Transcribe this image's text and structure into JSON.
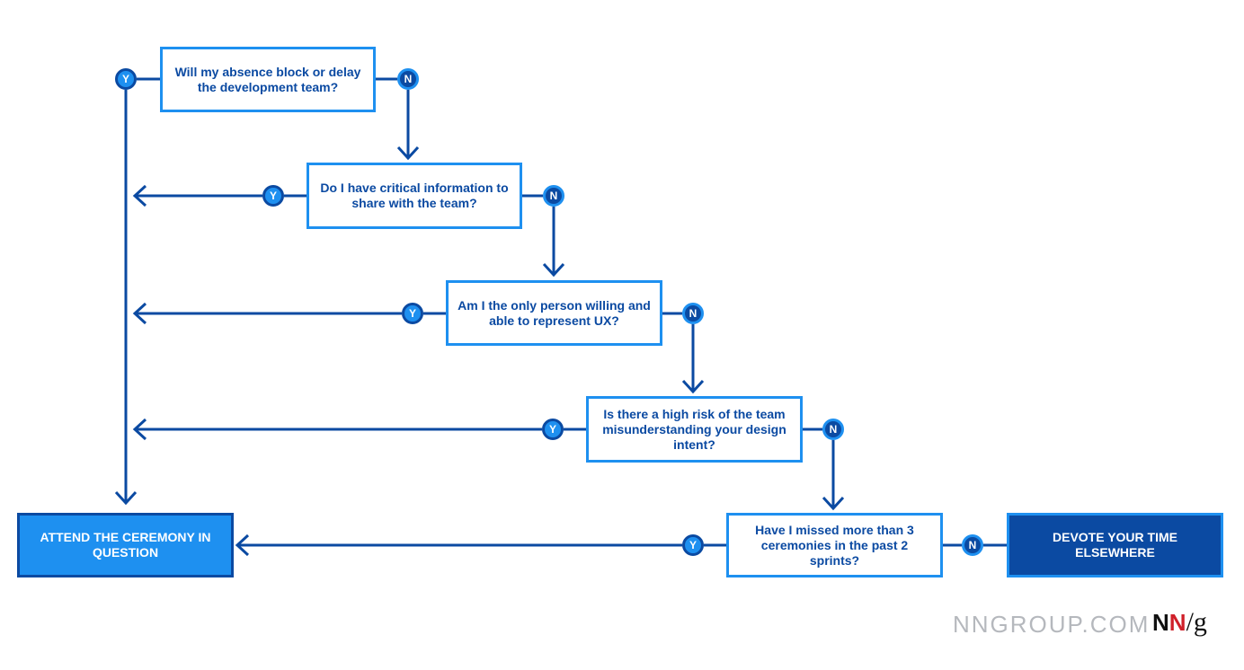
{
  "diagram": {
    "questions": [
      {
        "id": "q1",
        "text": "Will my absence block or delay the development team?"
      },
      {
        "id": "q2",
        "text": "Do I have critical information to share with the team?"
      },
      {
        "id": "q3",
        "text": "Am I the only person willing and able to represent UX?"
      },
      {
        "id": "q4",
        "text": "Is there a high risk of the team misunderstanding your design intent?"
      },
      {
        "id": "q5",
        "text": "Have I missed more than 3 ceremonies in the past 2 sprints?"
      }
    ],
    "outcomes": {
      "attend": "ATTEND THE CEREMONY IN QUESTION",
      "devote": "DEVOTE YOUR TIME ELSEWHERE"
    },
    "labels": {
      "yes": "Y",
      "no": "N"
    },
    "edges": [
      {
        "from": "q1",
        "label": "Y",
        "to": "attend"
      },
      {
        "from": "q1",
        "label": "N",
        "to": "q2"
      },
      {
        "from": "q2",
        "label": "Y",
        "to": "attend"
      },
      {
        "from": "q2",
        "label": "N",
        "to": "q3"
      },
      {
        "from": "q3",
        "label": "Y",
        "to": "attend"
      },
      {
        "from": "q3",
        "label": "N",
        "to": "q4"
      },
      {
        "from": "q4",
        "label": "Y",
        "to": "attend"
      },
      {
        "from": "q4",
        "label": "N",
        "to": "q5"
      },
      {
        "from": "q5",
        "label": "Y",
        "to": "attend"
      },
      {
        "from": "q5",
        "label": "N",
        "to": "devote"
      }
    ],
    "colors": {
      "light_blue": "#1e90f0",
      "dark_blue": "#0b4aa2"
    }
  },
  "footer": {
    "site": "NNGROUP.COM",
    "logo_n1": "N",
    "logo_n2": "N",
    "logo_rest": "/g"
  }
}
